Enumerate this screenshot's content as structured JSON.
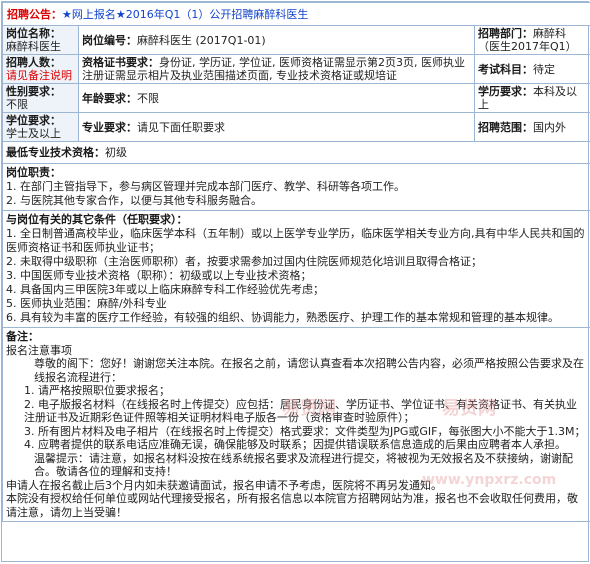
{
  "notice": {
    "label": "招聘公告：",
    "title": "★网上报名★2016年Q1（1）公开招聘麻醉科医生"
  },
  "row1": {
    "pos_name_label": "岗位名称：",
    "pos_name": "麻醉科医生",
    "pos_code_label": "岗位编号：",
    "pos_code": "麻醉科医生 (2017Q1-01)",
    "dept_label": "招聘部门：",
    "dept": "麻醉科（医生2017年Q1）"
  },
  "row2": {
    "count_label": "招聘人数：",
    "count": "请见备注说明",
    "cert_label": "资格证书要求：",
    "cert": "身份证, 学历证, 学位证, 医师资格证需显示第2页3页, 医师执业注册证需显示相片及执业范围描述页面, 专业技术资格证或规培证",
    "exam_label": "考试科目：",
    "exam": "待定"
  },
  "row3": {
    "gender_label": "性别要求：",
    "gender": "不限",
    "age_label": "年龄要求：",
    "age": "不限",
    "edu_label": "学历要求：",
    "edu": "本科及以上"
  },
  "row4": {
    "degree_label": "学位要求：",
    "degree": "学士及以上",
    "major_label": "专业要求：",
    "major": "请见下面任职要求",
    "scope_label": "招聘范围：",
    "scope": "国内外"
  },
  "qual": {
    "label": "最低专业技术资格：",
    "value": "初级"
  },
  "duty": {
    "heading": "岗位职责：",
    "lines": [
      "1. 在部门主管指导下，参与病区管理并完成本部门医疗、教学、科研等各项工作。",
      "2. 与医院其他专家合作，以便与其他专科服务融合。"
    ]
  },
  "req": {
    "heading": "与岗位有关的其它条件（任职要求）：",
    "lines": [
      "1. 全日制普通高校毕业，临床医学本科（五年制）或以上医学专业学历，临床医学相关专业方向,具有中华人民共和国的医师资格证书和医师执业证书；",
      "2. 未取得中级职称（主治医师职称）者，按要求需参加过国内住院医师规范化培训且取得合格证；",
      "3. 中国医师专业技术资格（职称）：初级或以上专业技术资格；",
      "4. 具备国内三甲医院3年或以上临床麻醉专科工作经验优先考虑；",
      "5. 医师执业范围：麻醉/外科专业",
      "6. 具有较为丰富的医疗工作经验，有较强的组织、协调能力，熟悉医疗、护理工作的基本常规和管理的基本规律。"
    ]
  },
  "notes": {
    "heading": "备注：",
    "sub": "报名注意事项",
    "intro": "尊敬的阁下：您好！谢谢您关注本院。在报名之前，请您认真查看本次招聘公告内容，必须严格按照公告要求及在线报名流程进行：",
    "items": [
      "1. 请严格按照职位要求报名；",
      "2. 电子版报名材料（在线报名时上传提交）应包括：居民身份证、学历证书、学位证书、有关资格证书、有关执业注册证书及近期彩色证件照等相关证明材料电子版各一份（资格审查时验原件）；",
      "3. 所有图片材料及电子相片（在线报名时上传提交）格式要求：文件类型为JPG或GIF，每张图大小不能大于1.3M；",
      "4. 应聘者提供的联系电话应准确无误，确保能够及时联系；因提供错误联系信息造成的后果由应聘者本人承担。"
    ],
    "tip": "温馨提示：请注意，如报名材料没按在线系统报名要求及流程进行提交，将被视为无效报名及不获接纳，谢谢配合。敬请各位的理解和支持！",
    "end1": "申请人在报名截止后3个月内如未获邀请面试，报名申请不予考虑，医院将不再另发通知。",
    "end2": "本院没有授权给任何单位或网站代理接受报名，所有报名信息以本院官方招聘网站为准，报名也不会收取任何费用，敬请注意，请勿上当受骗！"
  },
  "watermark": [
    "易贤网",
    "易贤网",
    "www.ynpxrz.com"
  ]
}
